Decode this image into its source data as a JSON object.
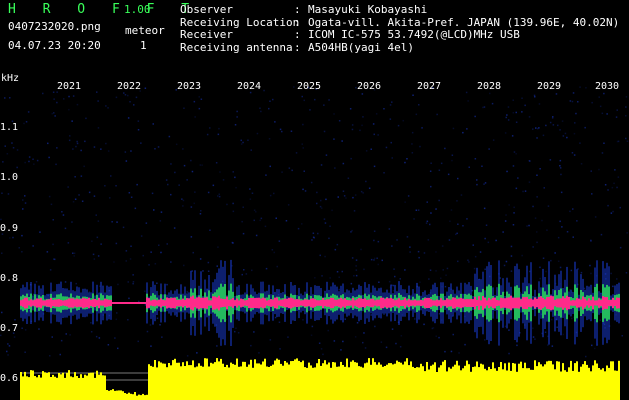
{
  "header": {
    "brand": "H R O F F T",
    "version": "1.00",
    "filename": "0407232020.png",
    "timestamp": "04.07.23 20:20",
    "meteor_label": "meteor",
    "meteor_count": "1",
    "info": [
      {
        "key": "Observer",
        "value": "Masayuki Kobayashi"
      },
      {
        "key": "Receiving Location",
        "value": "Ogata-vill. Akita-Pref. JAPAN (139.96E, 40.02N)"
      },
      {
        "key": "Receiver",
        "value": "ICOM IC-575 53.7492(@LCD)MHz USB"
      },
      {
        "key": "Receiving antenna",
        "value": "A504HB(yagi 4el)"
      }
    ]
  },
  "plot": {
    "unit_label": "kHz",
    "y_ticks": [
      "1.1",
      "1.0",
      "0.9",
      "0.8",
      "0.7",
      "0.6"
    ],
    "x_ticks": [
      "2021",
      "2022",
      "2023",
      "2024",
      "2025",
      "2026",
      "2027",
      "2028",
      "2029",
      "2030"
    ],
    "colors": {
      "signal_core": "#ff2a8a",
      "signal_halo": "#29d65c",
      "noise": "#1838c8",
      "level": "#ffff00"
    }
  }
}
